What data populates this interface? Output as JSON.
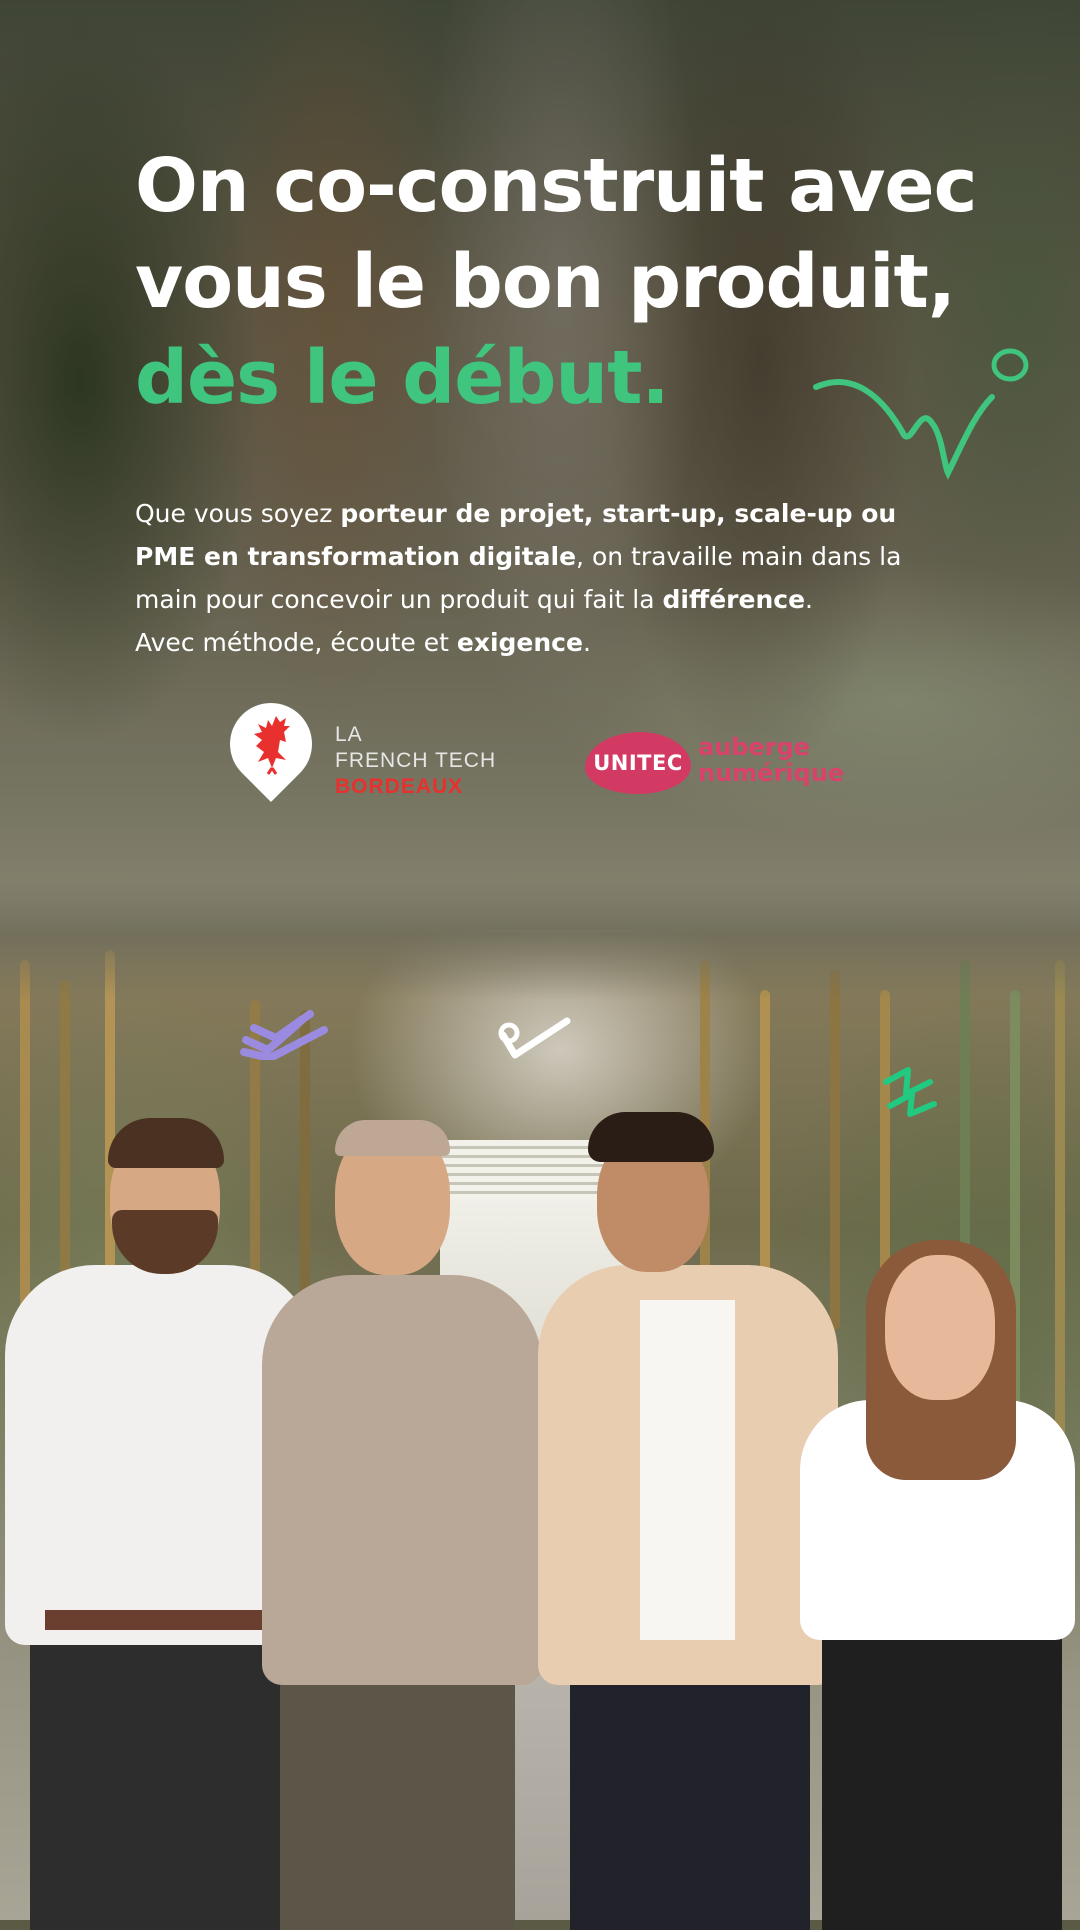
{
  "hero": {
    "headline_line1": "On co-construit avec",
    "headline_line2": "vous le bon produit,",
    "headline_accent": "dès le début.",
    "accent_color": "#3fc57d"
  },
  "intro": {
    "p1_plain_a": "Que vous soyez ",
    "p1_bold_a": "porteur de projet, start-up, scale-up ou PME en transformation digitale",
    "p1_plain_b": ", on travaille main dans la main pour concevoir un produit qui fait la ",
    "p1_bold_b": "différence",
    "p1_plain_c": ".",
    "p2_plain_a": "Avec méthode, écoute et ",
    "p2_bold_a": "exigence",
    "p2_plain_b": "."
  },
  "partners": {
    "french_tech": {
      "line1": "LA",
      "line2": "FRENCH TECH",
      "line3": "BORDEAUX",
      "icon": "rooster-icon",
      "accent_color": "#e8312f"
    },
    "unitec": {
      "badge": "UNITEC",
      "line1": "auberge",
      "line2": "numérique",
      "accent_color": "#d23a63"
    }
  },
  "decorations": {
    "squiggle_color": "#3fc57d",
    "check_color_purple": "#9b8be0",
    "check_color_white": "#ffffff",
    "zigzag_color": "#22c980"
  }
}
